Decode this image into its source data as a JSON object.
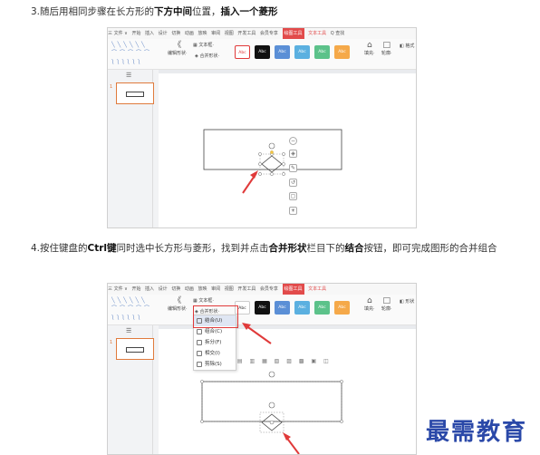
{
  "step3": {
    "prefix": "3.随后用相同步骤在长方形的",
    "bold1": "下方中间",
    "mid": "位置，",
    "bold2": "插入一个",
    "bold3": "菱形"
  },
  "step4": {
    "prefix": "4.按住键盘的",
    "bold1": "Ctrl键",
    "mid1": "同时选中长方形与菱形，找到并点击",
    "bold2": "合并形状",
    "mid2": "栏目下的",
    "bold3": "结合",
    "suffix": "按钮，即可完成图形的合并组合"
  },
  "screenshot1": {
    "menu_file": "三 文件 ∨",
    "menu_tabs": [
      "开始",
      "插入",
      "设计",
      "切换",
      "动画",
      "放映",
      "审阅",
      "视图",
      "开发工具",
      "会员专享"
    ],
    "active_tab": "绘图工具",
    "accent_tab": "文本工具",
    "search": "Q 查找",
    "edit_shape": "编辑形状·",
    "text_box": "文本框·",
    "merge_shape": "合并形状·",
    "style_buttons": [
      "Abc",
      "Abc",
      "Abc",
      "Abc",
      "Abc",
      "Abc"
    ],
    "fill_label": "填充·",
    "outline_label": "轮廓·",
    "format_label": "格式"
  },
  "screenshot2": {
    "menu_file": "三 文件 ∨",
    "menu_tabs": [
      "开始",
      "插入",
      "设计",
      "切换",
      "动画",
      "放映",
      "审阅",
      "视图",
      "开发工具",
      "会员专享"
    ],
    "active_tab": "绘图工具",
    "accent_tab": "文本工具",
    "edit_shape": "编辑形状·",
    "text_box": "文本框·",
    "merge_shape": "合并形状·",
    "style_buttons": [
      "Abc",
      "Abc",
      "Abc",
      "Abc",
      "Abc",
      "Abc"
    ],
    "fill_label": "填充·",
    "outline_label": "轮廓·",
    "format_label": "形状",
    "dropdown": [
      "结合(U)",
      "组合(C)",
      "拆分(F)",
      "相交(I)",
      "剪除(S)"
    ]
  },
  "colors": {
    "accent_red": "#e03a3a",
    "ribbon_active": "#e24b4b",
    "watermark": "#2a48a8",
    "style_colors": [
      "#ffffff",
      "#111111",
      "#5b8fd6",
      "#5bb0e0",
      "#5cc28a",
      "#f5a94a"
    ]
  },
  "watermark": "最需教育"
}
